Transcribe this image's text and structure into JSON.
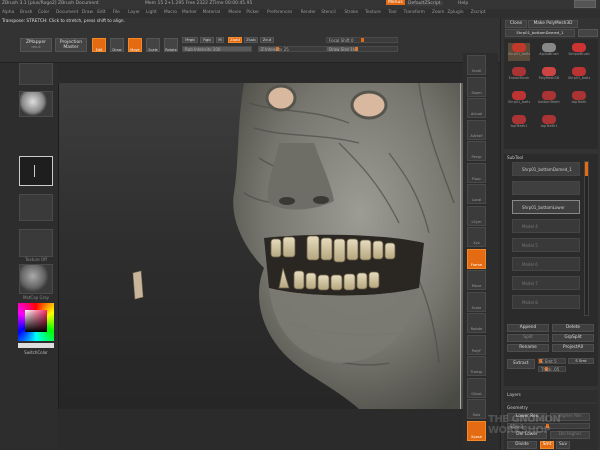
{
  "app": {
    "title": "ZBrush 3.1 [plus/Rogo2]   ZBrush Document",
    "stats": "Mem 15 2+1.295  Free 2322  ZTime 00:00:45.95",
    "menus_time_btn": "Menus",
    "default_zscript": "DefaultZScript",
    "help": "Help"
  },
  "menubar": [
    "Alpha",
    "Brush",
    "Color",
    "Document",
    "Draw",
    "Edit",
    "File",
    "Layer",
    "Light",
    "Macro",
    "Marker",
    "Material",
    "Movie",
    "Picker",
    "Preferences",
    "Render",
    "Stencil",
    "Stroke",
    "Texture",
    "Tool",
    "Transform",
    "Zoom",
    "Zplugin",
    "Zscript"
  ],
  "hint": "Transpose: STRETCH: Click to stretch, press shift to align.",
  "topshelf": {
    "zmapper": "ZMapper",
    "zmapper_sub": "rev-d",
    "projection_master": "Projection Master",
    "edit": "Edit",
    "draw": "Draw",
    "move": "Move",
    "scale": "Scale",
    "rotate": "Rotate",
    "mrgb": "Mrgb",
    "rgb": "Rgb",
    "m": "M",
    "zadd": "Zadd",
    "zsub": "Zsub",
    "zcut": "Zcut",
    "rgb_intensity": "Rgb Intensity 100",
    "z_intensity": "Z Intensity 25",
    "focal_shift": "Focal Shift 0",
    "draw_size": "Draw Size 102"
  },
  "leftshelf": {
    "btn1": "",
    "material": "",
    "alpha": "",
    "texture_off": "Texture Off",
    "matcap": "MatCap Gray",
    "switch_color": "SwitchColor"
  },
  "rightshelf": [
    "Scroll",
    "Zoom",
    "Actual",
    "AAHalf",
    "Persp",
    "Floor",
    "Local",
    "LSym",
    "Xyz",
    "Frame",
    "Move",
    "Scale",
    "Rotate",
    "PolyF",
    "Transp",
    "Ghost",
    "Solo",
    "Xpose"
  ],
  "tray": {
    "clone": "Clone",
    "make_polymesh": "Make PolyMesh3D",
    "current_tool": "Shrp01_bottomDomed_1",
    "tools": [
      "Shrp01_bottom",
      "AlphaBrush",
      "SimpleBrush",
      "EraserBrush",
      "PolyMesh3D",
      "Shrp01_bottom",
      "Shrp01_bottom",
      "bottomTeeth",
      "topTeeth",
      "topTeeth1",
      "topTeeth1"
    ],
    "subtool_title": "SubTool",
    "subtools": [
      "Shrp01_bottomDomed_1",
      "",
      "Shrp01_bottomLower",
      "Model 4",
      "Model 5",
      "Model 6",
      "Model 7",
      "Model 8"
    ],
    "append": "Append",
    "delete": "Delete",
    "split": "Split",
    "groups_split": "GrpSplit",
    "rename": "Rename",
    "project_all": "ProjectAll",
    "extract": "Extract",
    "e_smt": "E Smt 5",
    "s_smt": "S Smt",
    "thick": "Thick .05",
    "layers": "Layers",
    "geometry": "Geometry",
    "lower_res": "Lower Res",
    "higher_res": "Higher Res",
    "sdiv": "SDiv 3",
    "del_lower": "Del Lower",
    "del_higher": "Del Higher",
    "divide": "Divide",
    "smt": "Smt",
    "suv": "Suv"
  },
  "colors": {
    "accent": "#e46b12",
    "panel": "#333333",
    "viewport_bg": "#363636"
  },
  "watermark": "THE GNOMON WORKSHOP"
}
